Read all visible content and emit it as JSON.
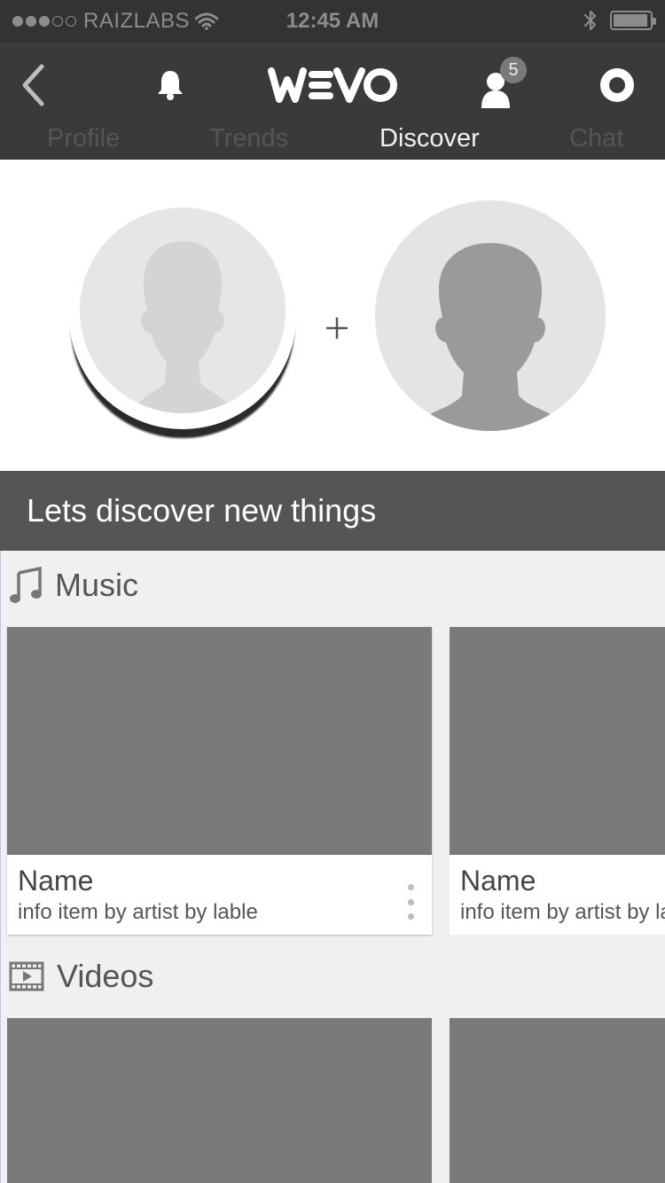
{
  "status_bar": {
    "signal_dots_filled": 3,
    "signal_dots_total": 5,
    "carrier": "RAIZLABS",
    "time": "12:45 AM",
    "battery_level": 0.95
  },
  "nav": {
    "back_icon": "chevron-left-icon",
    "bell_icon": "bell-icon",
    "logo_text": "WEVO",
    "user_icon": "user-icon",
    "user_badge": "5",
    "ring_icon": "record-icon"
  },
  "tabs": [
    {
      "label": "Profile",
      "active": false
    },
    {
      "label": "Trends",
      "active": false
    },
    {
      "label": "Discover",
      "active": true
    },
    {
      "label": "Chat",
      "active": false
    }
  ],
  "avatars": {
    "separator": "+"
  },
  "banner": {
    "text": "Lets discover new things"
  },
  "sections": {
    "music": {
      "icon": "music-note-icon",
      "title": "Music",
      "cards": [
        {
          "name": "Name",
          "info": "info item by artist by lable"
        },
        {
          "name": "Name",
          "info": "info item by artist by lable"
        }
      ]
    },
    "videos": {
      "icon": "film-icon",
      "title": "Videos"
    }
  },
  "colors": {
    "header_bg": "#3a3a3a",
    "status_bg": "#333333",
    "banner_bg": "#555555",
    "thumb_placeholder": "#7a7a7a",
    "active_tab": "#f2f2f2",
    "inactive_tab": "#555555"
  }
}
